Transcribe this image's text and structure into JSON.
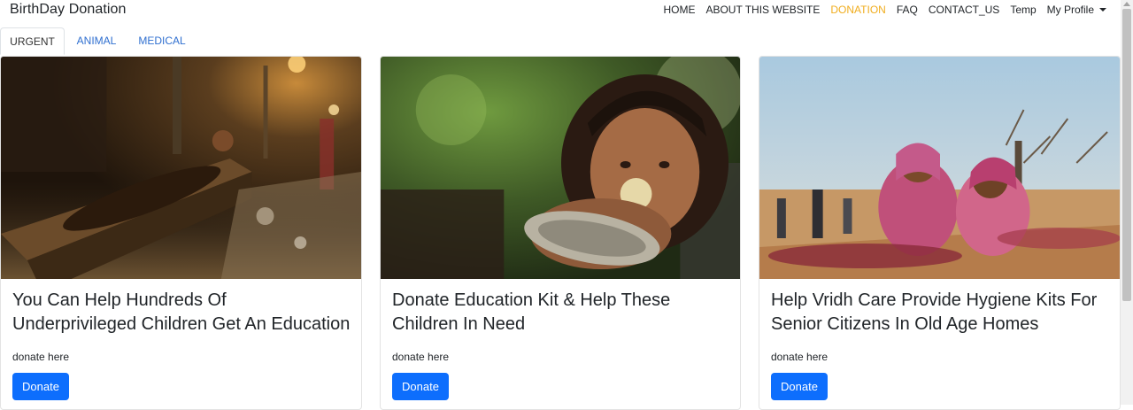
{
  "brand": "BirthDay Donation",
  "nav": {
    "home": "HOME",
    "about": "ABOUT THIS WEBSITE",
    "donation": "DONATION",
    "faq": "FAQ",
    "contact": "CONTACT_US",
    "temp": "Temp",
    "profile": "My Profile"
  },
  "tabs": [
    "URGENT",
    "ANIMAL",
    "MEDICAL"
  ],
  "cards": [
    {
      "title": "You Can Help Hundreds Of Underprivileged Children Get An Education",
      "text": "donate here",
      "button": "Donate",
      "image": "child-sleeping-on-bench-photo"
    },
    {
      "title": "Donate Education Kit & Help These Children In Need",
      "text": "donate here",
      "button": "Donate",
      "image": "child-eating-from-plate-photo"
    },
    {
      "title": "Help Vridh Care Provide Hygiene Kits For Senior Citizens In Old Age Homes",
      "text": "donate here",
      "button": "Donate",
      "image": "children-sitting-outdoors-photo"
    }
  ],
  "colors": {
    "accent": "#0d6efd",
    "active_nav": "#f0ad1e",
    "tab_link": "#2f6fd0"
  }
}
